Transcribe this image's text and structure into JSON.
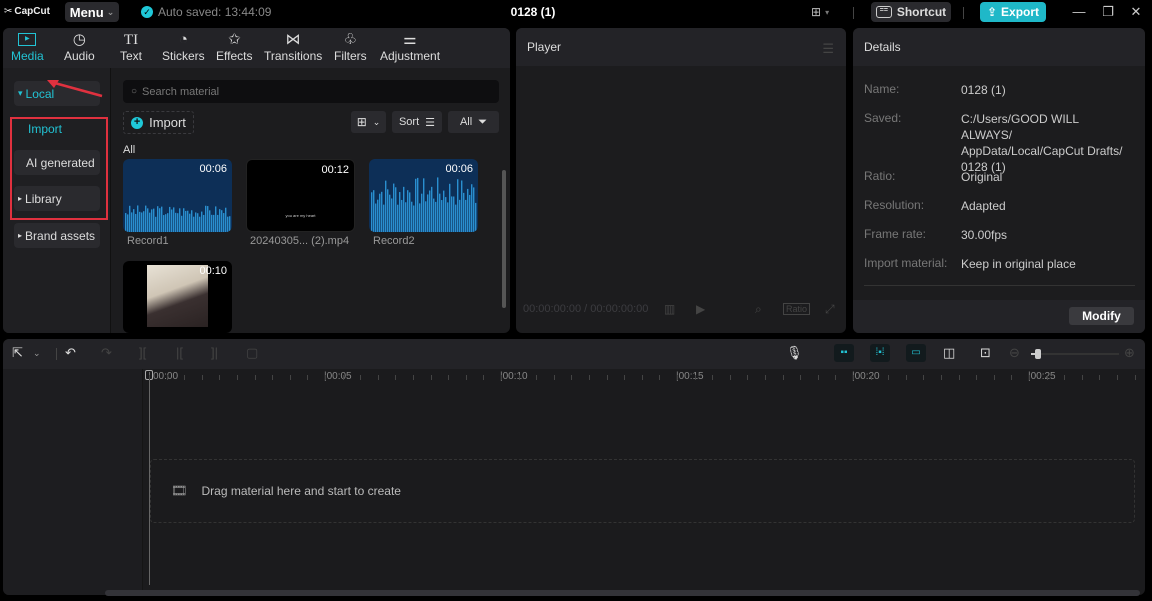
{
  "titlebar": {
    "app_name": "CapCut",
    "menu_label": "Menu",
    "autosave_text": "Auto saved: 13:44:09",
    "project_title": "0128 (1)",
    "shortcut_label": "Shortcut",
    "export_label": "Export",
    "export_color": "#1fb8c8"
  },
  "tabs": [
    {
      "label": "Media",
      "icon": "media-icon",
      "glyph": "▶",
      "active": true
    },
    {
      "label": "Audio",
      "icon": "audio-icon",
      "glyph": "♪"
    },
    {
      "label": "Text",
      "icon": "text-icon",
      "glyph": "TI"
    },
    {
      "label": "Stickers",
      "icon": "sticker-icon",
      "glyph": "◔"
    },
    {
      "label": "Effects",
      "icon": "effects-icon",
      "glyph": "✩"
    },
    {
      "label": "Transitions",
      "icon": "transitions-icon",
      "glyph": "⋈"
    },
    {
      "label": "Filters",
      "icon": "filters-icon",
      "glyph": "♧"
    },
    {
      "label": "Adjustment",
      "icon": "adjustment-icon",
      "glyph": "⚌"
    }
  ],
  "sidebar": {
    "items": [
      {
        "label": "Local",
        "prefix": "▾"
      },
      {
        "label": "Import",
        "prefix": ""
      },
      {
        "label": "AI generated",
        "prefix": ""
      },
      {
        "label": "Library",
        "prefix": "▸"
      },
      {
        "label": "Brand assets",
        "prefix": "▸"
      }
    ]
  },
  "media": {
    "search_placeholder": "Search material",
    "import_label": "Import",
    "sort_label": "Sort",
    "filter_label": "All",
    "section_label": "All",
    "items": [
      {
        "name": "Record1",
        "duration": "00:06",
        "type": "audio"
      },
      {
        "name": "20240305... (2).mp4",
        "duration": "00:12",
        "type": "video",
        "caption": "you are my heart"
      },
      {
        "name": "Record2",
        "duration": "00:06",
        "type": "audio"
      },
      {
        "name": "",
        "duration": "00:10",
        "type": "image"
      }
    ]
  },
  "player": {
    "title": "Player",
    "timecode": "00:00:00:00 / 00:00:00:00",
    "ratio_label": "Ratio"
  },
  "details": {
    "title": "Details",
    "rows": [
      {
        "key": "Name:",
        "value": "0128 (1)"
      },
      {
        "key": "Saved:",
        "value": "C:/Users/GOOD WILL ALWAYS/ AppData/Local/CapCut Drafts/ 0128 (1)"
      },
      {
        "key": "Ratio:",
        "value": "Original"
      },
      {
        "key": "Resolution:",
        "value": "Adapted"
      },
      {
        "key": "Frame rate:",
        "value": "30.00fps"
      },
      {
        "key": "Import material:",
        "value": "Keep in original place"
      }
    ],
    "modify_label": "Modify"
  },
  "timeline": {
    "ruler_labels": [
      "00:00",
      "|00:05",
      "|00:10",
      "|00:15",
      "|00:20",
      "|00:25"
    ],
    "dropzone_text": "Drag material here and start to create"
  }
}
